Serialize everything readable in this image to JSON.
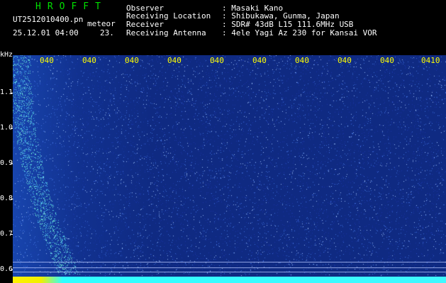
{
  "header": {
    "app_title": "HROFFT",
    "file_name": "UT2512010400.pn",
    "meteor_label": "meteor",
    "datetime": "25.12.01 04:00",
    "count": "23."
  },
  "info": [
    {
      "label": "Observer",
      "value": ": Masaki Kano"
    },
    {
      "label": "Receiving Location",
      "value": ": Shibukawa, Gunma, Japan"
    },
    {
      "label": "Receiver",
      "value": ": SDR# 43dB L15 111.6MHz USB"
    },
    {
      "label": "Receiving Antenna",
      "value": ": 4ele Yagi Az 230 for Kansai VOR"
    }
  ],
  "axis": {
    "unit": "kHz",
    "y_labels": [
      "1.1",
      "1.0",
      "0.9",
      "0.8",
      "0.7",
      "0.6"
    ],
    "x_labels": [
      "040",
      "040",
      "040",
      "040",
      "040",
      "040",
      "040",
      "040",
      "040",
      "0410"
    ]
  },
  "colors": {
    "title": "#00e000",
    "text": "#ffffff",
    "time_labels": "#ffff00",
    "background": "#0f2a82",
    "strip": "#3ff8ff"
  }
}
